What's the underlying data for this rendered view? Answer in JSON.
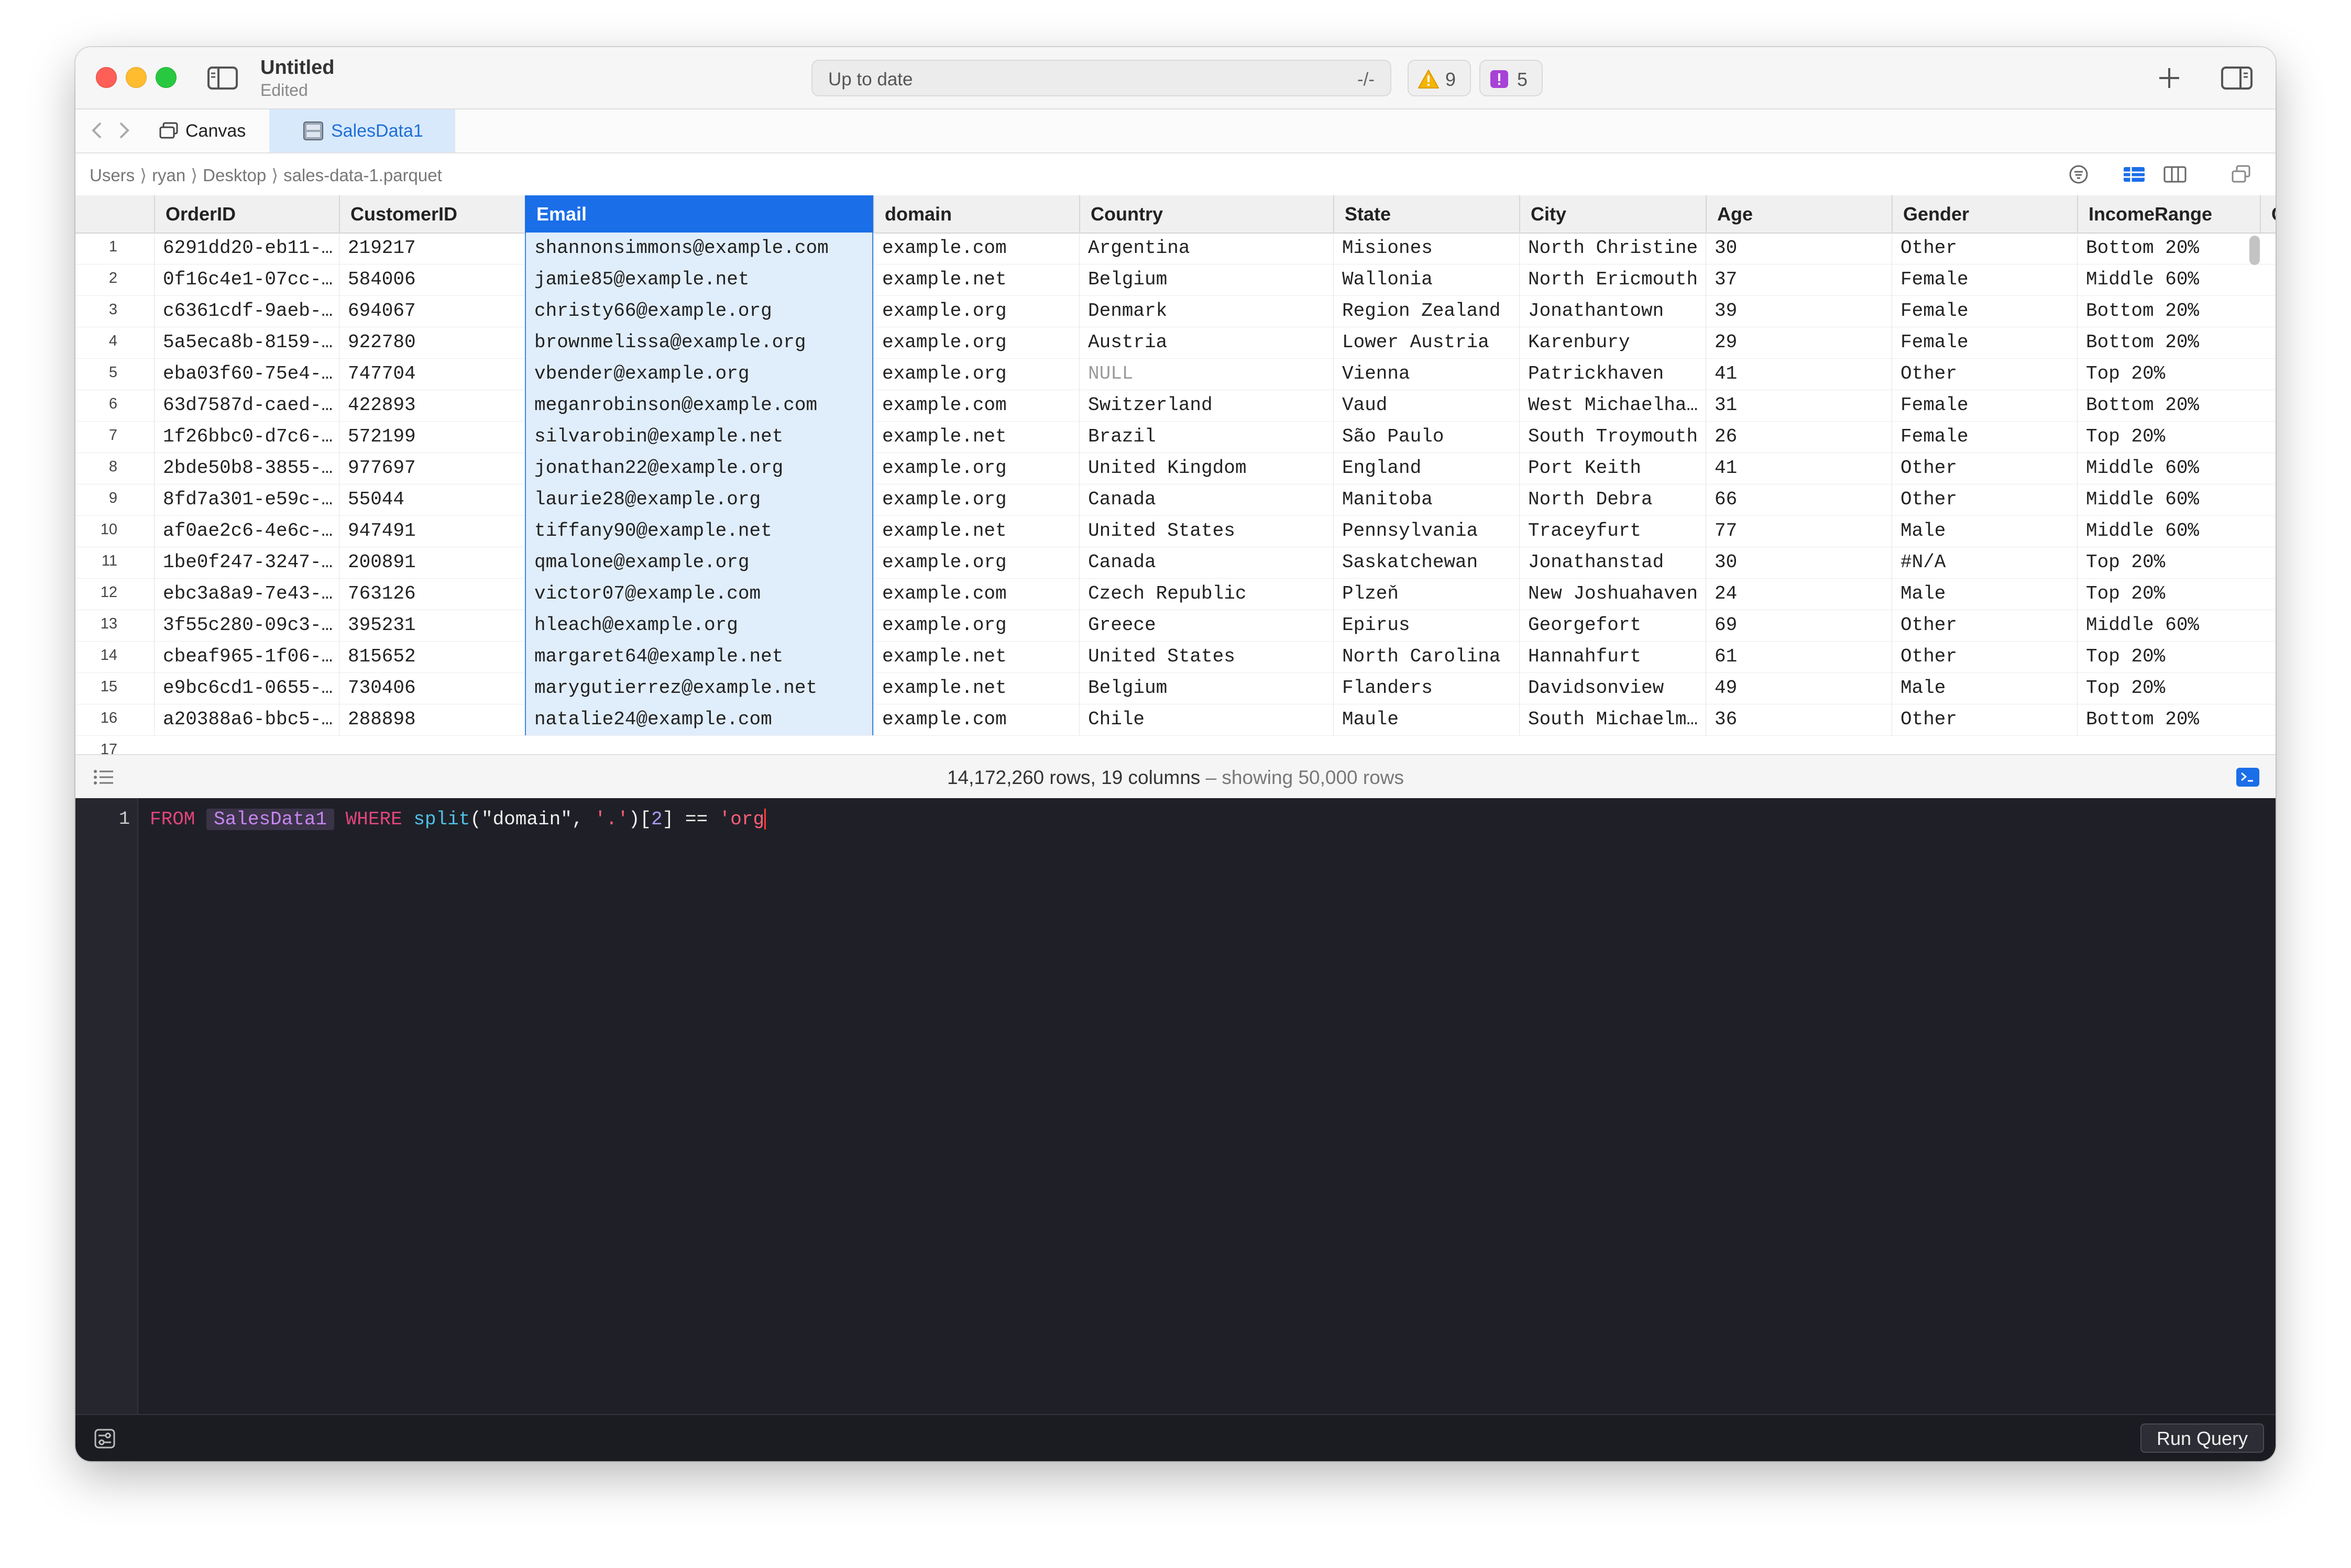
{
  "window": {
    "title": "Untitled",
    "subtitle": "Edited",
    "status_text": "Up to date",
    "status_right": "-/-",
    "warnings_count": "9",
    "errors_count": "5",
    "accent_color": "#1a6ee8"
  },
  "tabs": [
    {
      "label": "Canvas",
      "icon": "canvas-icon"
    },
    {
      "label": "SalesData1",
      "icon": "database-icon",
      "active": true
    }
  ],
  "breadcrumb": [
    "Users",
    "ryan",
    "Desktop",
    "sales-data-1.parquet"
  ],
  "table": {
    "columns": [
      "OrderID",
      "CustomerID",
      "Email",
      "domain",
      "Country",
      "State",
      "City",
      "Age",
      "Gender",
      "IncomeRange",
      "C"
    ],
    "selected_column": "Email",
    "rows": [
      [
        "6291dd20-eb11-…",
        "219217",
        "shannonsimmons@example.com",
        "example.com",
        "Argentina",
        "Misiones",
        "North Christine",
        "30",
        "Other",
        "Bottom 20%"
      ],
      [
        "0f16c4e1-07cc-…",
        "584006",
        "jamie85@example.net",
        "example.net",
        "Belgium",
        "Wallonia",
        "North Ericmouth",
        "37",
        "Female",
        "Middle 60%"
      ],
      [
        "c6361cdf-9aeb-…",
        "694067",
        "christy66@example.org",
        "example.org",
        "Denmark",
        "Region Zealand",
        "Jonathantown",
        "39",
        "Female",
        "Bottom 20%"
      ],
      [
        "5a5eca8b-8159-…",
        "922780",
        "brownmelissa@example.org",
        "example.org",
        "Austria",
        "Lower Austria",
        "Karenbury",
        "29",
        "Female",
        "Bottom 20%"
      ],
      [
        "eba03f60-75e4-…",
        "747704",
        "vbender@example.org",
        "example.org",
        "NULL",
        "Vienna",
        "Patrickhaven",
        "41",
        "Other",
        "Top 20%"
      ],
      [
        "63d7587d-caed-…",
        "422893",
        "meganrobinson@example.com",
        "example.com",
        "Switzerland",
        "Vaud",
        "West Michaelha…",
        "31",
        "Female",
        "Bottom 20%"
      ],
      [
        "1f26bbc0-d7c6-…",
        "572199",
        "silvarobin@example.net",
        "example.net",
        "Brazil",
        "São Paulo",
        "South Troymouth",
        "26",
        "Female",
        "Top 20%"
      ],
      [
        "2bde50b8-3855-…",
        "977697",
        "jonathan22@example.org",
        "example.org",
        "United Kingdom",
        "England",
        "Port Keith",
        "41",
        "Other",
        "Middle 60%"
      ],
      [
        "8fd7a301-e59c-…",
        "55044",
        "laurie28@example.org",
        "example.org",
        "Canada",
        "Manitoba",
        "North Debra",
        "66",
        "Other",
        "Middle 60%"
      ],
      [
        "af0ae2c6-4e6c-…",
        "947491",
        "tiffany90@example.net",
        "example.net",
        "United States",
        "Pennsylvania",
        "Traceyfurt",
        "77",
        "Male",
        "Middle 60%"
      ],
      [
        "1be0f247-3247-…",
        "200891",
        "qmalone@example.org",
        "example.org",
        "Canada",
        "Saskatchewan",
        "Jonathanstad",
        "30",
        "#N/A",
        "Top 20%"
      ],
      [
        "ebc3a8a9-7e43-…",
        "763126",
        "victor07@example.com",
        "example.com",
        "Czech Republic",
        "Plzeň",
        "New Joshuahaven",
        "24",
        "Male",
        "Top 20%"
      ],
      [
        "3f55c280-09c3-…",
        "395231",
        "hleach@example.org",
        "example.org",
        "Greece",
        "Epirus",
        "Georgefort",
        "69",
        "Other",
        "Middle 60%"
      ],
      [
        "cbeaf965-1f06-…",
        "815652",
        "margaret64@example.net",
        "example.net",
        "United States",
        "North Carolina",
        "Hannahfurt",
        "61",
        "Other",
        "Top 20%"
      ],
      [
        "e9bc6cd1-0655-…",
        "730406",
        "marygutierrez@example.net",
        "example.net",
        "Belgium",
        "Flanders",
        "Davidsonview",
        "49",
        "Male",
        "Top 20%"
      ],
      [
        "a20388a6-bbc5-…",
        "288898",
        "natalie24@example.com",
        "example.com",
        "Chile",
        "Maule",
        "South Michaelm…",
        "36",
        "Other",
        "Bottom 20%"
      ]
    ],
    "row_numbers": [
      "1",
      "2",
      "3",
      "4",
      "5",
      "6",
      "7",
      "8",
      "9",
      "10",
      "11",
      "12",
      "13",
      "14",
      "15",
      "16",
      "17"
    ]
  },
  "status": {
    "rows_cols": "14,172,260 rows, 19 columns",
    "showing": " – showing 50,000 rows"
  },
  "editor": {
    "line_number": "1",
    "tokens": {
      "from": "FROM",
      "table": "SalesData1",
      "where": "WHERE",
      "func": "split",
      "open": "(",
      "arg1": "\"domain\"",
      "comma": ", ",
      "arg2": "'.'",
      "close_idx": ")[",
      "index": "2",
      "close_br": "] == ",
      "value": "'org"
    }
  },
  "run_button": "Run Query"
}
